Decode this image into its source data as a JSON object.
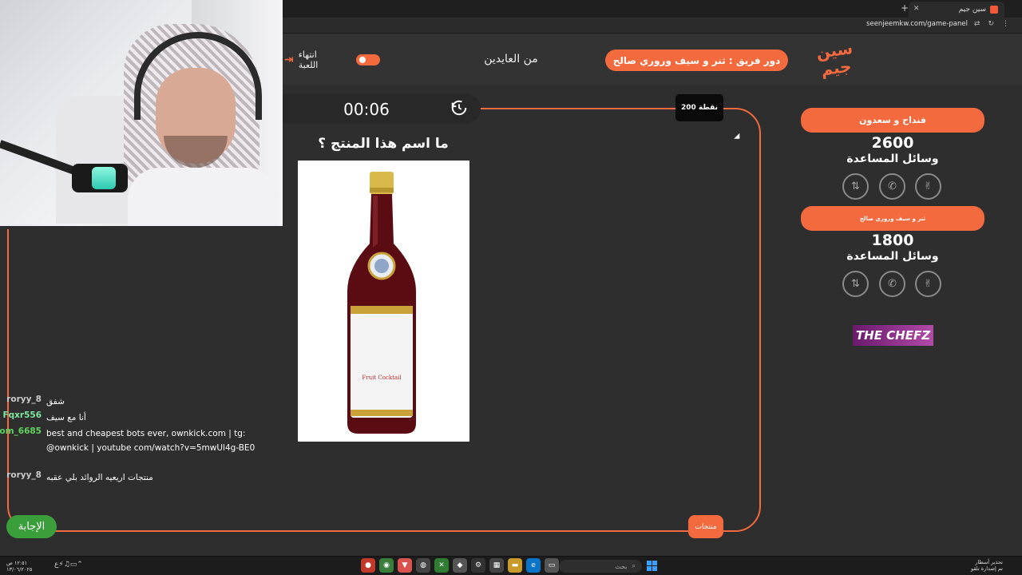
{
  "browser": {
    "tab_title": "سين جيم",
    "url": "seenjeemkw.com/game-panel",
    "new_tab": "+",
    "close": "✕"
  },
  "header": {
    "logo_text": "سين جيم",
    "turn_label": "دور فريق : ثنر و سيف وروري صالح",
    "category": "من العايدين",
    "end_game_label": "انتهاء اللعبة"
  },
  "question": {
    "timer": "00:06",
    "points": "200 نقطة",
    "text": "ما اسم هذا المنتج ؟"
  },
  "buttons": {
    "answer": "الإجابة",
    "category_tag": "منتجات"
  },
  "chat": [
    {
      "user": "roryy_8",
      "text": "شفق",
      "color": "#c9c9c9"
    },
    {
      "user": "Fqxr556",
      "text": "أنا مع سيف",
      "color": "#7ee6a0"
    },
    {
      "user": "com_6685",
      "text": "best and cheapest bots ever, ownkick.com | tg: @ownkick | youtube com/watch?v=5mwUl4g-BE0",
      "color": "#5fd35f"
    },
    {
      "user": "roryy_8",
      "text": "منتجات اريعيه الروائد بلي عقبه",
      "color": "#c9c9c9"
    }
  ],
  "teams": [
    {
      "name": "فنداح و سعدون",
      "score": "2600",
      "helpers_label": "وسائل المساعدة"
    },
    {
      "name": "ثنر و سيف وروري صالح",
      "score": "1800",
      "helpers_label": "وسائل المساعدة"
    }
  ],
  "sponsor": "THE CHEFZ",
  "taskbar": {
    "time": "١٢:٥١ ص",
    "date": "١٣/٠٦/٢٠٢٥",
    "search_placeholder": "بحث",
    "notif_line1": "تحذير أسطار",
    "notif_line2": "تم إصدارة تلقو"
  },
  "colors": {
    "accent": "#f26a3d",
    "background": "#2e2e2e",
    "answer_green": "#3a9e3a",
    "points_bg": "#0a0a0a"
  }
}
